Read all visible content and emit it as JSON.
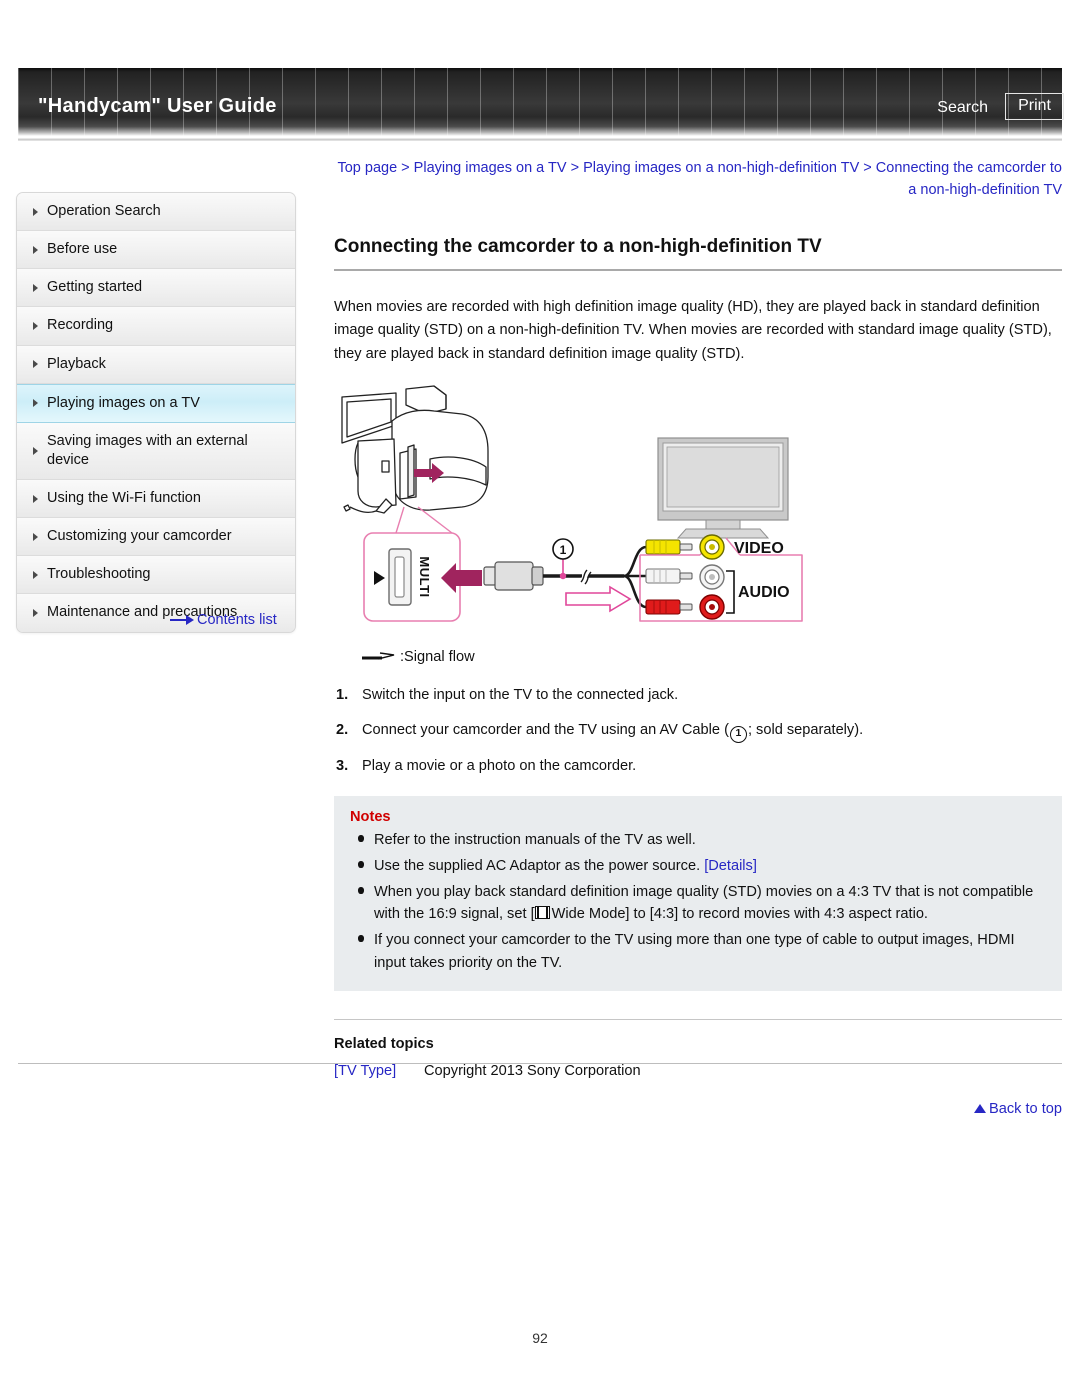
{
  "header": {
    "site_title": "\"Handycam\" User Guide",
    "search_label": "Search",
    "print_label": "Print"
  },
  "sidebar": {
    "items": [
      {
        "label": "Operation Search",
        "active": false
      },
      {
        "label": "Before use",
        "active": false
      },
      {
        "label": "Getting started",
        "active": false
      },
      {
        "label": "Recording",
        "active": false
      },
      {
        "label": "Playback",
        "active": false
      },
      {
        "label": "Playing images on a TV",
        "active": true
      },
      {
        "label": "Saving images with an external device",
        "active": false
      },
      {
        "label": "Using the Wi-Fi function",
        "active": false
      },
      {
        "label": "Customizing your camcorder",
        "active": false
      },
      {
        "label": "Troubleshooting",
        "active": false
      },
      {
        "label": "Maintenance and precautions",
        "active": false
      }
    ],
    "contents_list_label": "Contents list"
  },
  "main": {
    "breadcrumb": "Top page > Playing images on a TV > Playing images on a non-high-definition TV > Connecting the camcorder to a non-high-definition TV",
    "page_title": "Connecting the camcorder to a non-high-definition TV",
    "intro_paragraph": "When movies are recorded with high definition image quality (HD), they are played back in standard definition image quality (STD) on a non-high-definition TV. When movies are recorded with standard image quality (STD), they are played back in standard definition image quality (STD).",
    "illustration": {
      "multi_port_label": "MULTI",
      "video_label": "VIDEO",
      "audio_label": "AUDIO",
      "cable_callout": "1",
      "colors": {
        "callout_frame": "#e87fb0",
        "arrow_magenta": "#a0245e",
        "video_yellow": "#f5e400",
        "audio_red": "#e01b1b",
        "audio_white": "#f2f2f2",
        "device_outline": "#222222",
        "tv_screen": "#dcdcdc"
      }
    },
    "signal_flow_label": ":Signal flow",
    "steps": [
      {
        "num": "1.",
        "text_before": "Switch the input on the TV to the connected jack.",
        "circle": "",
        "text_after": ""
      },
      {
        "num": "2.",
        "text_before": "Connect your camcorder and the TV using an AV Cable (",
        "circle": "1",
        "text_after": "; sold separately)."
      },
      {
        "num": "3.",
        "text_before": "Play a movie or a photo on the camcorder.",
        "circle": "",
        "text_after": ""
      }
    ],
    "notes": {
      "title": "Notes",
      "items": [
        {
          "text": "Refer to the instruction manuals of the TV as well."
        },
        {
          "text": "Use the supplied AC Adaptor as the power source.",
          "link": "[Details]"
        },
        {
          "text_a": "When you play back standard definition image quality (STD) movies on a 4:3 TV that is not compatible with the 16:9 signal, set [",
          "icon": "wide-mode-icon",
          "text_b": "Wide Mode] to [4:3] to record movies with 4:3 aspect ratio."
        },
        {
          "text": "If you connect your camcorder to the TV using more than one type of cable to output images, HDMI input takes priority on the TV."
        }
      ]
    },
    "related": {
      "title": "Related topics",
      "link": "[TV Type]"
    },
    "back_to_top": "Back to top"
  },
  "footer": {
    "copyright": "Copyright 2013 Sony Corporation",
    "page_number": "92"
  }
}
